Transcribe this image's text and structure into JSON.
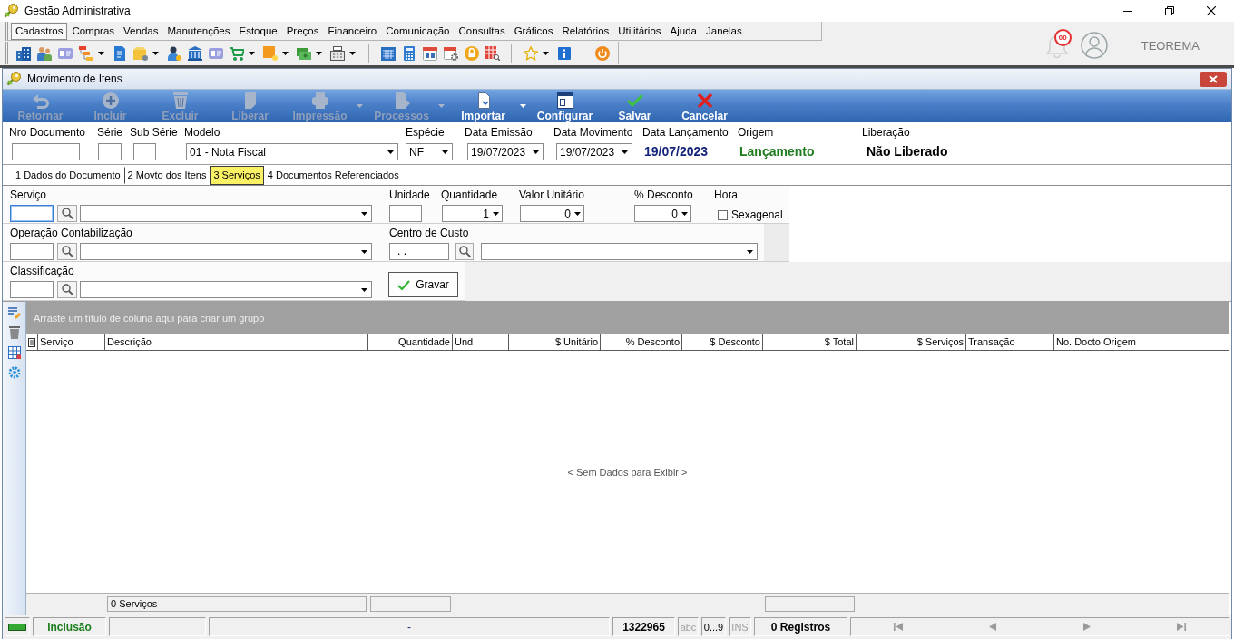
{
  "window": {
    "title": "Gestão Administrativa"
  },
  "menu": [
    {
      "label": "Cadastros",
      "selected": true
    },
    {
      "label": "Compras",
      "selected": false
    },
    {
      "label": "Vendas",
      "selected": false
    },
    {
      "label": "Manutenções",
      "selected": false
    },
    {
      "label": "Estoque",
      "selected": false
    },
    {
      "label": "Preços",
      "selected": false
    },
    {
      "label": "Financeiro",
      "selected": false
    },
    {
      "label": "Comunicação",
      "selected": false
    },
    {
      "label": "Consultas",
      "selected": false
    },
    {
      "label": "Gráficos",
      "selected": false
    },
    {
      "label": "Relatórios",
      "selected": false
    },
    {
      "label": "Utilitários",
      "selected": false
    },
    {
      "label": "Ajuda",
      "selected": false
    },
    {
      "label": "Janelas",
      "selected": false
    }
  ],
  "notifications": {
    "badge": "00"
  },
  "user": {
    "name": "TEOREMA"
  },
  "document_window": {
    "title": "Movimento de Itens"
  },
  "toolbar": [
    {
      "kind": "back",
      "label": "Retornar",
      "disabled": true,
      "menu": false
    },
    {
      "kind": "add",
      "label": "Incluir",
      "disabled": true,
      "menu": false
    },
    {
      "kind": "delete",
      "label": "Excluir",
      "disabled": true,
      "menu": false
    },
    {
      "kind": "release",
      "label": "Liberar",
      "disabled": true,
      "menu": false
    },
    {
      "kind": "print",
      "label": "Impressão",
      "disabled": true,
      "menu": true
    },
    {
      "kind": "process",
      "label": "Processos",
      "disabled": true,
      "menu": true
    },
    {
      "kind": "import",
      "label": "Importar",
      "disabled": false,
      "menu": true
    },
    {
      "kind": "configure",
      "label": "Configurar",
      "disabled": false,
      "menu": false
    },
    {
      "kind": "save",
      "label": "Salvar",
      "disabled": false,
      "menu": false
    },
    {
      "kind": "cancel",
      "label": "Cancelar",
      "disabled": false,
      "menu": false
    }
  ],
  "header": [
    {
      "kind": "input",
      "label": "Nro Documento"
    },
    {
      "kind": "input",
      "label": "Série"
    },
    {
      "kind": "input",
      "label": "Sub Série"
    },
    {
      "kind": "select",
      "label": "Modelo",
      "value": "01 - Nota Fiscal"
    },
    {
      "kind": "select",
      "label": "Espécie",
      "value": "NF"
    },
    {
      "kind": "select",
      "label": "Data Emissão",
      "value": "19/07/2023"
    },
    {
      "kind": "select",
      "label": "Data Movimento",
      "value": "19/07/2023"
    },
    {
      "kind": "display",
      "label": "Data Lançamento",
      "value": "19/07/2023",
      "color": "#14247a"
    },
    {
      "kind": "display",
      "label": "Origem",
      "value": "Lançamento",
      "color": "#1e7b1e"
    },
    {
      "kind": "display",
      "label": "Liberação",
      "value": "Não Liberado",
      "color": "#000000"
    }
  ],
  "tabs": [
    {
      "label": "1 Dados do Documento",
      "selected": false
    },
    {
      "label": "2 Movto dos Itens",
      "selected": false
    },
    {
      "label": "3 Serviços",
      "selected": true
    },
    {
      "label": "4 Documentos Referenciados",
      "selected": false
    }
  ],
  "form": [
    {
      "fields": [
        {
          "kind": "lookup",
          "label": "Serviço",
          "focused": true
        },
        {
          "kind": "input",
          "label": "Unidade"
        },
        {
          "kind": "spin",
          "label": "Quantidade",
          "value": "1"
        },
        {
          "kind": "spin",
          "label": "Valor Unitário",
          "value": "0"
        },
        {
          "kind": "spin",
          "label": "% Desconto",
          "value": "0"
        },
        {
          "kind": "checkbox",
          "label": "Hora",
          "option": "Sexagenal",
          "checked": false
        }
      ]
    },
    {
      "fields": [
        {
          "kind": "lookup",
          "label": "Operação Contabilização",
          "focused": false
        },
        {
          "kind": "lookup",
          "label": "Centro de Custo",
          "value": ". .",
          "focused": false
        }
      ]
    },
    {
      "fields": [
        {
          "kind": "lookup",
          "label": "Classificação",
          "focused": false
        },
        {
          "kind": "button",
          "label": "Gravar"
        }
      ]
    }
  ],
  "grid": {
    "group_hint": "Arraste um título de coluna aqui para criar um grupo",
    "columns": [
      {
        "label": "Serviço",
        "numeric": false,
        "summary": false
      },
      {
        "label": "Descrição",
        "numeric": false,
        "summary": true,
        "summary_text": "0 Serviços"
      },
      {
        "label": "Quantidade",
        "numeric": true,
        "summary": true
      },
      {
        "label": "Und",
        "numeric": false,
        "summary": false
      },
      {
        "label": "$ Unitário",
        "numeric": true,
        "summary": false
      },
      {
        "label": "% Desconto",
        "numeric": true,
        "summary": false
      },
      {
        "label": "$ Desconto",
        "numeric": true,
        "summary": false
      },
      {
        "label": "$ Total",
        "numeric": true,
        "summary": true
      },
      {
        "label": "$ Serviços",
        "numeric": true,
        "summary": false
      },
      {
        "label": "Transação",
        "numeric": false,
        "summary": false
      },
      {
        "label": "No. Docto Origem",
        "numeric": false,
        "summary": false
      }
    ],
    "empty_text": "< Sem Dados para Exibir >"
  },
  "status_bar": {
    "mode": "Inclusão",
    "message": "-",
    "number": "1322965",
    "keys": [
      {
        "label": "abc",
        "on": false
      },
      {
        "label": "0...9",
        "on": true
      },
      {
        "label": "INS",
        "on": false
      }
    ],
    "records": "0 Registros",
    "navigation": [
      {
        "kind": "first",
        "disabled": true
      },
      {
        "kind": "previous",
        "disabled": true
      },
      {
        "kind": "next",
        "disabled": true
      },
      {
        "kind": "last",
        "disabled": true
      }
    ]
  }
}
